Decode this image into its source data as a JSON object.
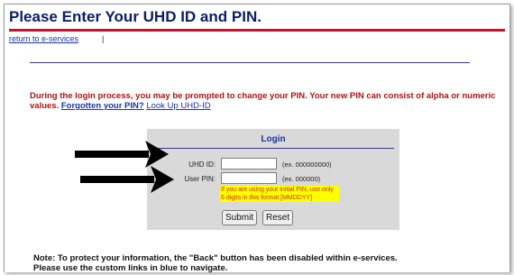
{
  "page": {
    "title": "Please Enter Your UHD ID and PIN.",
    "return_link": "return to e-services",
    "return_separator": "|"
  },
  "info": {
    "text": "During the login process, you may be prompted to change your PIN. Your new PIN can consist of alpha or numeric values.",
    "forgotten_pin_link": "Forgotten your PIN?",
    "lookup_link": "Look Up UHD-ID"
  },
  "login": {
    "title": "Login",
    "uhd_id_label": "UHD ID:",
    "uhd_id_value": "",
    "uhd_id_example": "(ex. 000000000)",
    "pin_label": "User PIN:",
    "pin_value": "",
    "pin_example": "(ex. 000000)",
    "pin_hint": "If you are using your initial PIN, use only 6 digits in this format [MMDDYY]",
    "submit_label": "Submit",
    "reset_label": "Reset"
  },
  "note": {
    "line1": "Note: To protect your information, the \"Back\" button has been disabled within e-services.",
    "line2": "Please use the custom links in blue to navigate."
  },
  "colors": {
    "title": "#0b1e6b",
    "accent_rule": "#c8102e",
    "info_text": "#b01010",
    "link": "#1a33a8",
    "login_bg": "#d9d9d9",
    "hint_bg": "#ffff00"
  },
  "icons": [
    "arrow-right-icon",
    "arrow-right-icon"
  ]
}
